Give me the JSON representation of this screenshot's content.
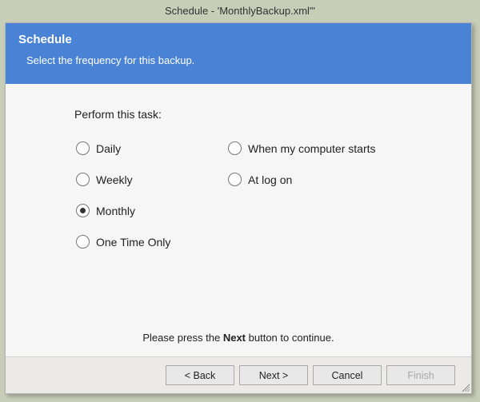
{
  "window": {
    "title": "Schedule -  'MonthlyBackup.xml\"'"
  },
  "banner": {
    "title": "Schedule",
    "subtitle": "Select the frequency for this backup."
  },
  "body": {
    "prompt": "Perform this task:",
    "options": {
      "daily": "Daily",
      "weekly": "Weekly",
      "monthly": "Monthly",
      "one_time": "One Time Only",
      "computer_starts": "When my computer starts",
      "at_logon": "At log on"
    },
    "selected": "monthly"
  },
  "footer": {
    "text_before": "Please press the ",
    "text_bold": "Next",
    "text_after": "  button to continue."
  },
  "buttons": {
    "back": "< Back",
    "next": "Next >",
    "cancel": "Cancel",
    "finish": "Finish"
  }
}
